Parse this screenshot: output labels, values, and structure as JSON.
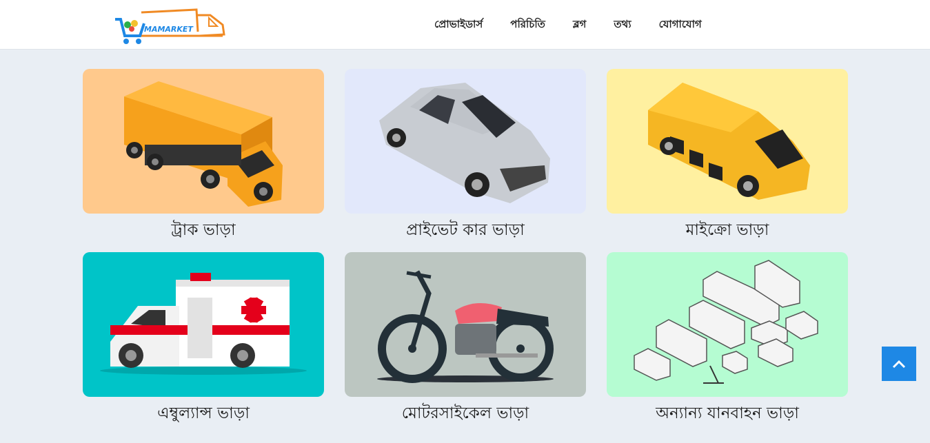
{
  "header": {
    "logo_text": "MAMARKET",
    "nav": [
      {
        "label": "প্রোভাইডার্স"
      },
      {
        "label": "পরিচিতি"
      },
      {
        "label": "ব্লগ"
      },
      {
        "label": "তথ্য"
      },
      {
        "label": "যোগাযোগ"
      }
    ]
  },
  "services": [
    {
      "title": "ট্রাক ভাড়া",
      "bg": "#ffc98c",
      "icon": "truck-image"
    },
    {
      "title": "প্রাইভেট কার ভাড়া",
      "bg": "#e2e8fb",
      "icon": "car-image"
    },
    {
      "title": "মাইক্রো ভাড়া",
      "bg": "#fff0a0",
      "icon": "microbus-image"
    },
    {
      "title": "এম্বুল্যান্স ভাড়া",
      "bg": "#00c4c8",
      "icon": "ambulance-image"
    },
    {
      "title": "মোটরসাইকেল ভাড়া",
      "bg": "#bcc6c1",
      "icon": "motorcycle-image"
    },
    {
      "title": "অন্যান্য যানবাহন ভাড়া",
      "bg": "#b5fcd2",
      "icon": "vehicles-image"
    }
  ],
  "colors": {
    "accent": "#1e88e5",
    "logo_orange": "#f08a24",
    "logo_blue": "#1e88e5"
  },
  "scroll_top_icon": "chevron-up-icon"
}
